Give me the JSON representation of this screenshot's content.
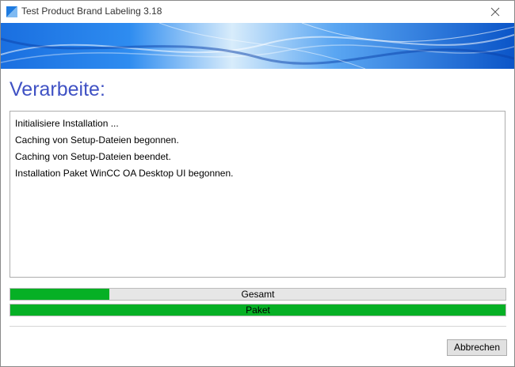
{
  "window": {
    "title": "Test Product Brand Labeling 3.18"
  },
  "icons": {
    "app": "app-icon",
    "close": "close-icon"
  },
  "colors": {
    "accent": "#4052c4",
    "progress": "#06b025",
    "banner": "#1a6fe0"
  },
  "heading": "Verarbeite:",
  "log": [
    "Initialisiere Installation ...",
    "Caching von Setup-Dateien begonnen.",
    "Caching von Setup-Dateien beendet.",
    "Installation Paket WinCC OA Desktop UI begonnen."
  ],
  "progress": {
    "total": {
      "label": "Gesamt",
      "fraction": 0.2
    },
    "package": {
      "label": "Paket",
      "fraction": 1.0
    }
  },
  "buttons": {
    "cancel": "Abbrechen"
  }
}
